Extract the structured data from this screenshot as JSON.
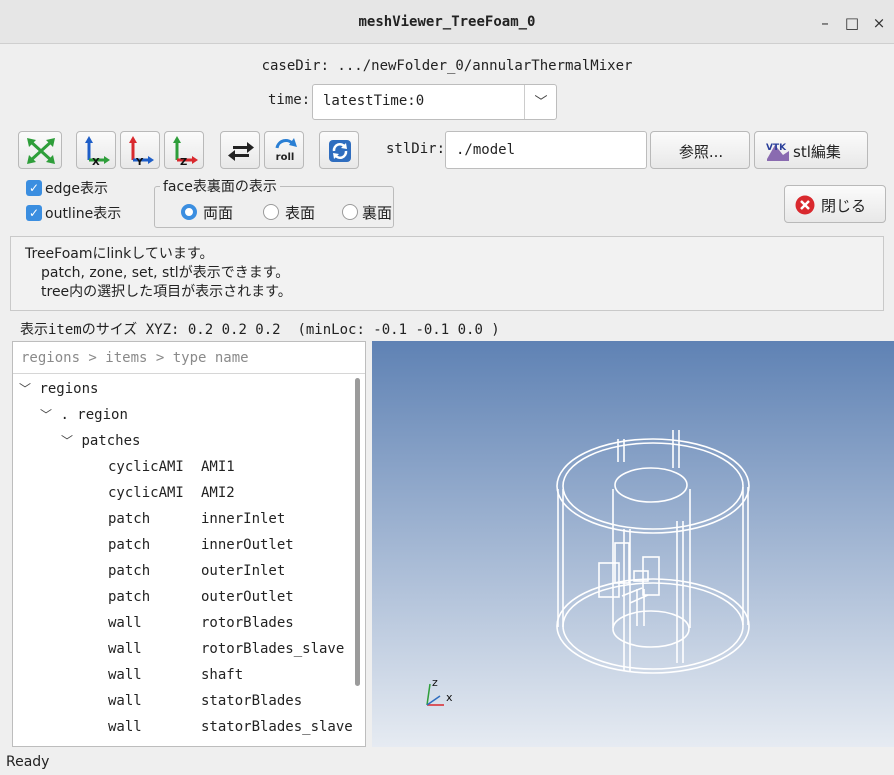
{
  "window": {
    "title": "meshViewer_TreeFoam_0"
  },
  "case_dir": "caseDir: .../newFolder_0/annularThermalMixer",
  "time": {
    "label": "time:",
    "value": "latestTime:0"
  },
  "toolbar": {
    "roll_label": "roll",
    "axis_labels": {
      "x": "X",
      "y": "Y",
      "z": "Z"
    },
    "stl_dir_label": "stlDir:",
    "stl_dir_value": "./model",
    "browse_label": "参照...",
    "stl_edit_label": "stl編集"
  },
  "options": {
    "edge_label": "edge表示",
    "outline_label": "outline表示",
    "face_group_label": "face表裏面の表示",
    "radio": {
      "both": "両面",
      "front": "表面",
      "back": "裏面"
    },
    "selected_face": "both"
  },
  "close_label": "閉じる",
  "message": {
    "line1": "TreeFoamにlinkしています。",
    "line2": "patch, zone, set, stlが表示できます。",
    "line3": "tree内の選択した項目が表示されます。"
  },
  "size_info": "表示itemのサイズ XYZ: 0.2 0.2 0.2  (minLoc: -0.1 -0.1 0.0 )",
  "tree": {
    "header": "regions > items > type name",
    "root": "regions",
    "region": ". region",
    "patches_label": "patches",
    "items": [
      {
        "type": "cyclicAMI",
        "name": "AMI1"
      },
      {
        "type": "cyclicAMI",
        "name": "AMI2"
      },
      {
        "type": "patch",
        "name": "innerInlet"
      },
      {
        "type": "patch",
        "name": "innerOutlet"
      },
      {
        "type": "patch",
        "name": "outerInlet"
      },
      {
        "type": "patch",
        "name": "outerOutlet"
      },
      {
        "type": "wall",
        "name": "rotorBlades"
      },
      {
        "type": "wall",
        "name": "rotorBlades_slave"
      },
      {
        "type": "wall",
        "name": "shaft"
      },
      {
        "type": "wall",
        "name": "statorBlades"
      },
      {
        "type": "wall",
        "name": "statorBlades_slave"
      }
    ]
  },
  "viewport": {
    "axis_labels": {
      "x": "x",
      "z": "z"
    },
    "bg_top": "#5f82b4",
    "bg_bottom": "#e6ebf2"
  },
  "status": "Ready",
  "colors": {
    "accent": "#3b8ee0",
    "close_red": "#d9292e"
  }
}
